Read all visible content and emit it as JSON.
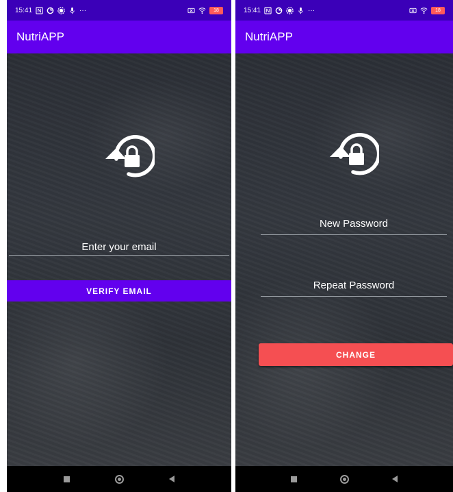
{
  "status_bar": {
    "time": "15:41",
    "battery": "18",
    "more": "···"
  },
  "app": {
    "title": "NutriAPP"
  },
  "verify_screen": {
    "email_field": {
      "placeholder": "Enter your email"
    },
    "verify_button": {
      "label": "VERIFY EMAIL"
    }
  },
  "change_screen": {
    "new_password": {
      "placeholder": "New Password"
    },
    "repeat_password": {
      "placeholder": "Repeat Password"
    },
    "change_button": {
      "label": "CHANGE"
    }
  },
  "icons": [
    "lock-reset-icon",
    "square-nav-icon",
    "home-nav-icon",
    "back-nav-icon"
  ],
  "colors": {
    "appbar": "#6200ee",
    "statusbar": "#3b00b8",
    "verify_button": "#6200ee",
    "change_button": "#f54f52"
  }
}
